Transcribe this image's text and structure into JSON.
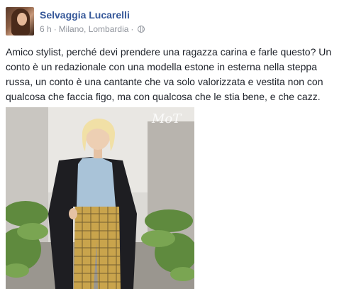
{
  "post": {
    "author": "Selvaggia Lucarelli",
    "time": "6 h",
    "separator": "·",
    "location": "Milano, Lombardia",
    "privacy_icon": "globe-icon",
    "text": "Amico stylist, perché devi prendere una ragazza carina e farle questo? Un conto è un redazionale con una modella estone in esterna nella steppa russa, un conto è una cantante che va solo valorizzata e vestita non con qualcosa che faccia figo, ma con qualcosa che le stia bene, e che cazz.",
    "photo_watermark": "MoT"
  },
  "colors": {
    "link": "#365899",
    "meta": "#90949c",
    "text": "#1d2129"
  }
}
